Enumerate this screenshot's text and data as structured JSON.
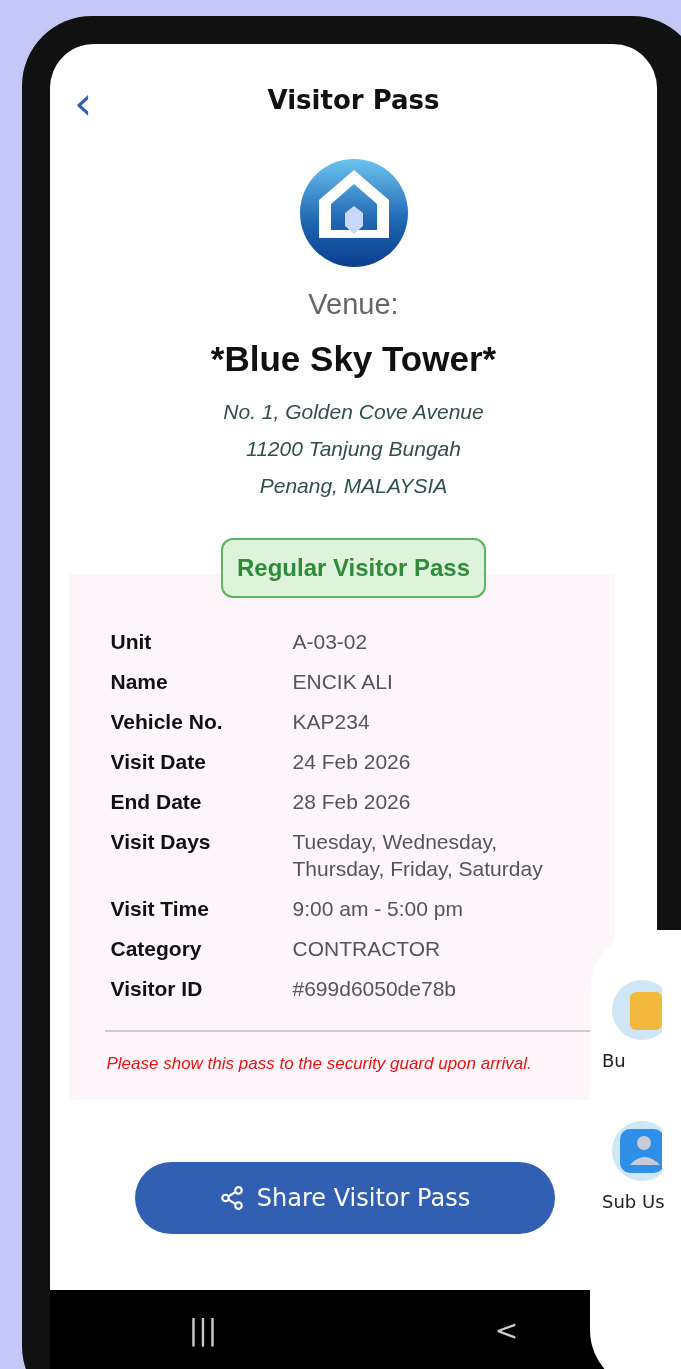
{
  "header": {
    "back": "‹",
    "title": "Visitor Pass"
  },
  "venue": {
    "label": "Venue:",
    "name": "*Blue Sky Tower*",
    "address": [
      "No. 1, Golden Cove Avenue",
      "11200 Tanjung Bungah",
      "Penang, MALAYSIA"
    ]
  },
  "pass_type": "Regular Visitor Pass",
  "details": [
    {
      "label": "Unit",
      "value": "A-03-02"
    },
    {
      "label": "Name",
      "value": "ENCIK ALI"
    },
    {
      "label": "Vehicle No.",
      "value": "KAP234"
    },
    {
      "label": "Visit Date",
      "value": "24 Feb 2026"
    },
    {
      "label": "End Date",
      "value": "28 Feb 2026"
    },
    {
      "label": "Visit Days",
      "value": "Tuesday, Wednesday, Thursday, Friday, Saturday"
    },
    {
      "label": "Visit Time",
      "value": "9:00 am - 5:00 pm"
    },
    {
      "label": "Category",
      "value": "CONTRACTOR"
    },
    {
      "label": "Visitor ID",
      "value": "#699d6050de78b"
    }
  ],
  "notice": "Please show this pass to the security guard upon arrival.",
  "share_button": "Share Visitor Pass",
  "nav_bar": {
    "recents": "|||",
    "back": "<"
  },
  "overlay_card": [
    {
      "kind": "folder",
      "label": "Bu"
    },
    {
      "kind": "user",
      "label": "Sub Us"
    }
  ]
}
